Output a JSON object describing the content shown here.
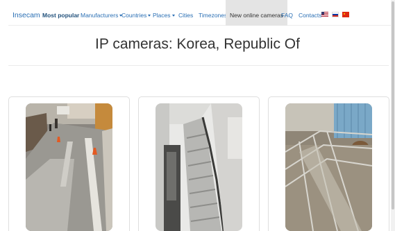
{
  "navbar": {
    "brand": "Insecam",
    "items": [
      {
        "label": "Most popular",
        "dropdown": false,
        "bold": true
      },
      {
        "label": "Manufacturers",
        "dropdown": true
      },
      {
        "label": "Countries",
        "dropdown": true
      },
      {
        "label": "Places",
        "dropdown": true
      },
      {
        "label": "Cities",
        "dropdown": false
      },
      {
        "label": "Timezones",
        "dropdown": false
      },
      {
        "label": "New online cameras",
        "dropdown": false,
        "active": true
      },
      {
        "label": "FAQ",
        "dropdown": false
      },
      {
        "label": "Contacts",
        "dropdown": false
      }
    ],
    "flags": [
      "us-flag-icon",
      "russia-flag-icon",
      "china-flag-icon"
    ]
  },
  "page": {
    "title": "IP cameras: Korea, Republic Of"
  },
  "cameras": [
    {
      "scene": "street-corner-camera-thumbnail"
    },
    {
      "scene": "stairwell-camera-thumbnail"
    },
    {
      "scene": "livestock-pen-camera-thumbnail"
    }
  ],
  "colors": {
    "link": "#2a6fb4",
    "active_tab_bg": "#e4e4e4",
    "title": "#333333",
    "card_border": "#dedede"
  }
}
